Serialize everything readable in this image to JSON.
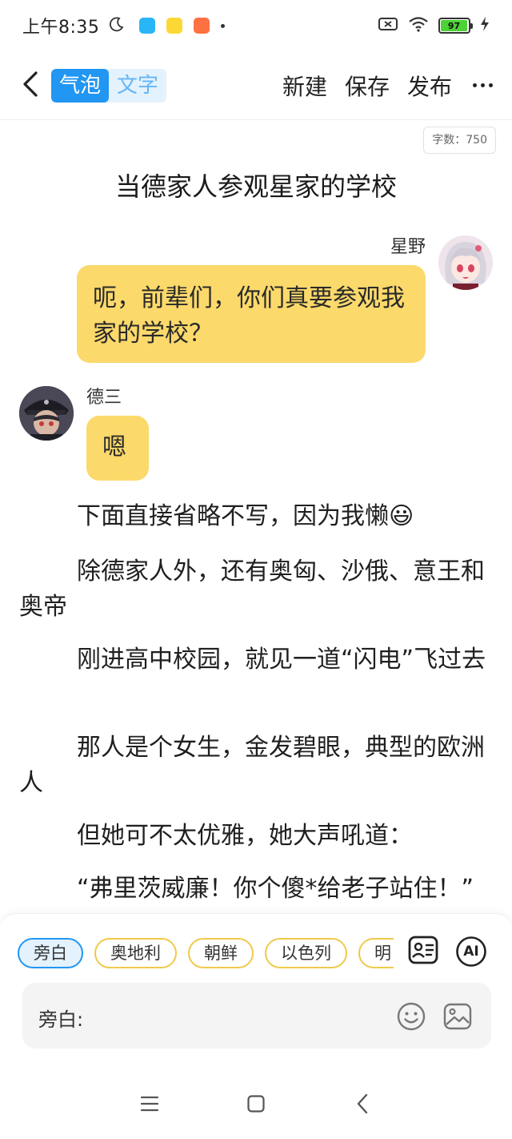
{
  "status_bar": {
    "time": "上午8:35",
    "battery": "97",
    "battery_level": 0.97
  },
  "header": {
    "mode_bubble": "气泡",
    "mode_text": "文字",
    "new_label": "新建",
    "save_label": "保存",
    "publish_label": "发布"
  },
  "document": {
    "word_count": "字数：750",
    "title": "当德家人参观星家的学校",
    "messages": [
      {
        "speaker": "星野",
        "text": "呃，前辈们，你们真要参观我家的学校？",
        "side": "right"
      },
      {
        "speaker": "德三",
        "text": "嗯",
        "side": "left"
      }
    ],
    "paragraphs": [
      "下面直接省略不写，因为我懒😃",
      "除德家人外，还有奥匈、沙俄、意王和奥帝",
      "刚进高中校园，就见一道“闪电”飞过去",
      "那人是个女生，金发碧眼，典型的欧洲人",
      "但她可不太优雅，她大声吼道：",
      "“弗里茨威廉！你个傻*给老子站住！”"
    ]
  },
  "composer": {
    "chips": [
      "旁白",
      "奥地利",
      "朝鲜",
      "以色列",
      "明"
    ],
    "selected_chip": "旁白",
    "ai_label": "AI",
    "input_label": "旁白:",
    "input_value": ""
  },
  "colors": {
    "accent": "#2196f3",
    "bubble": "#fbd96b",
    "chip_border": "#f0c94a"
  }
}
